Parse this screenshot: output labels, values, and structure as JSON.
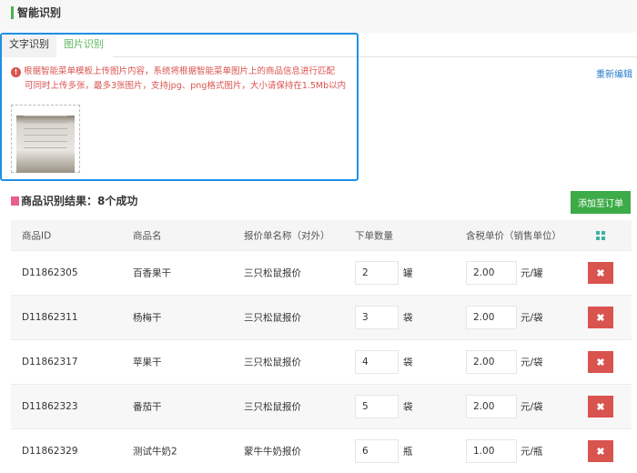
{
  "page": {
    "title": "智能识别"
  },
  "tabs": [
    {
      "label": "文字识别",
      "active": false
    },
    {
      "label": "图片识别",
      "active": true
    }
  ],
  "notice": {
    "line1": "根据智能菜单模板上传图片内容，系统将根据智能菜单图片上的商品信息进行匹配",
    "line2": "可同时上传多张，最多3张图片，支持jpg、png格式图片，大小请保持在1.5Mb以内",
    "icon": "exclamation-icon"
  },
  "reedit_label": "重新编辑",
  "result": {
    "title": "商品识别结果：8个成功",
    "add_button": "添加至订单"
  },
  "table": {
    "headers": [
      "商品ID",
      "商品名",
      "报价单名称（对外）",
      "下单数量",
      "含税单价（销售单位）"
    ],
    "rows": [
      {
        "id": "D11862305",
        "name": "百香果干",
        "quote": "三只松鼠报价",
        "qty": "2",
        "unit": "罐",
        "price": "2.00",
        "price_unit": "元/罐"
      },
      {
        "id": "D11862311",
        "name": "杨梅干",
        "quote": "三只松鼠报价",
        "qty": "3",
        "unit": "袋",
        "price": "2.00",
        "price_unit": "元/袋"
      },
      {
        "id": "D11862317",
        "name": "苹果干",
        "quote": "三只松鼠报价",
        "qty": "4",
        "unit": "袋",
        "price": "2.00",
        "price_unit": "元/袋"
      },
      {
        "id": "D11862323",
        "name": "番茄干",
        "quote": "三只松鼠报价",
        "qty": "5",
        "unit": "袋",
        "price": "2.00",
        "price_unit": "元/袋"
      },
      {
        "id": "D11862329",
        "name": "测试牛奶2",
        "quote": "蒙牛牛奶报价",
        "qty": "6",
        "unit": "瓶",
        "price": "1.00",
        "price_unit": "元/瓶"
      }
    ],
    "delete_symbol": "✖"
  },
  "colors": {
    "accent": "#5cb85c",
    "danger": "#d9534f",
    "focus": "#1e90e6"
  }
}
